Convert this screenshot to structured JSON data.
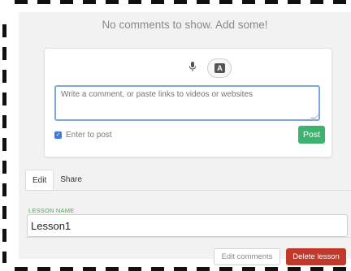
{
  "comments": {
    "empty_message": "No comments to show. Add some!",
    "input_placeholder": "Write a comment, or paste links to videos or websites",
    "enter_to_post_label": "Enter to post",
    "enter_to_post_checked": true,
    "post_label": "Post",
    "keyboard_button_glyph": "A",
    "icons": [
      "microphone-icon",
      "keyboard-icon"
    ]
  },
  "tabs": [
    {
      "label": "Edit",
      "active": true
    },
    {
      "label": "Share",
      "active": false
    }
  ],
  "lesson": {
    "name_label": "LESSON NAME",
    "name_value": "Lesson1"
  },
  "footer": {
    "edit_comments_label": "Edit comments",
    "delete_label": "Delete lesson"
  },
  "colors": {
    "post_button": "#3cb371",
    "delete_button": "#c0392b",
    "field_label": "#4caf50",
    "input_focus_border": "#7ea7e0"
  }
}
